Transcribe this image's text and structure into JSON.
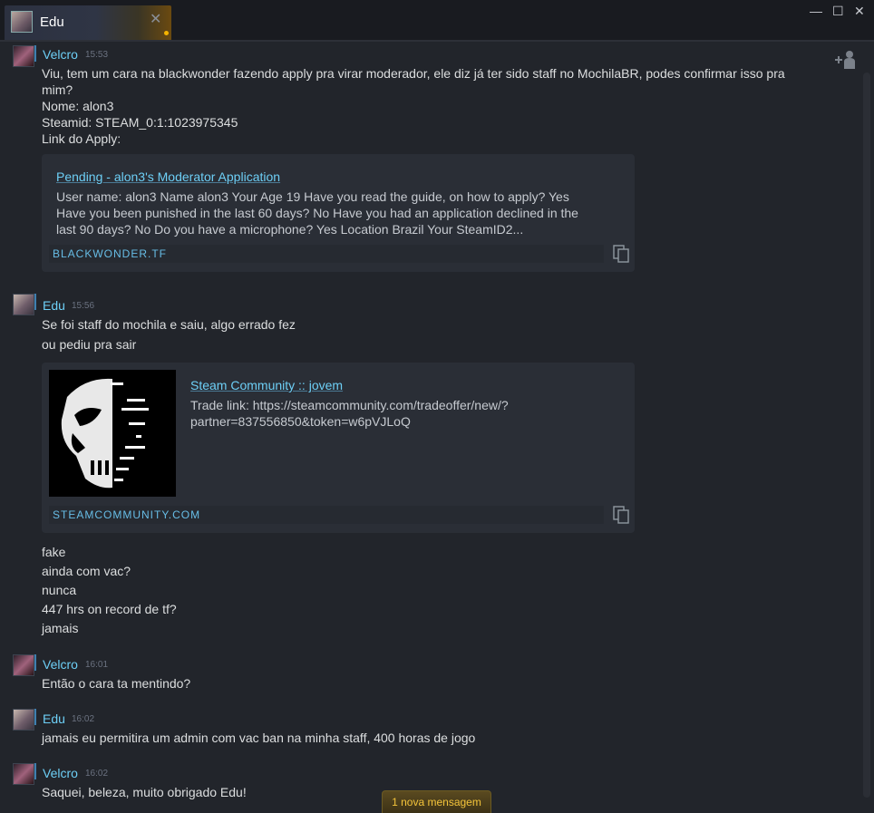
{
  "tab": {
    "title": "Edu"
  },
  "window": {
    "minimize": "—",
    "maximize": "☐",
    "close": "✕"
  },
  "messages": [
    {
      "sender": "Velcro",
      "time": "15:53",
      "lines": [
        "Viu, tem um cara na blackwonder fazendo apply pra virar moderador, ele diz já ter sido staff no MochilaBR, podes confirmar isso pra",
        "mim?",
        "Nome: alon3",
        "Steamid: STEAM_0:1:1023975345",
        "Link do Apply:"
      ],
      "embed": {
        "title": "Pending - alon3's Moderator Application",
        "desc": [
          "User name: alon3 Name alon3 Your Age 19 Have you read the guide, on how to apply? Yes",
          "Have you been punished in the last 60 days? No Have you had an application declined in the",
          "last 90 days? No Do you have a microphone? Yes Location Brazil Your SteamID2..."
        ],
        "domain": "BLACKWONDER.TF"
      }
    },
    {
      "sender": "Edu",
      "time": "15:56",
      "lines": [
        "Se foi staff do mochila e saiu, algo errado fez",
        "ou pediu pra sair"
      ],
      "embed": {
        "title": "Steam Community :: jovem",
        "desc": [
          "Trade link: https://steamcommunity.com/tradeoffer/new/?",
          "partner=837556850&token=w6pVJLoQ"
        ],
        "domain": "STEAMCOMMUNITY.COM"
      },
      "after_lines": [
        "fake",
        "ainda com vac?",
        "nunca",
        "447 hrs on record de tf?",
        "jamais"
      ]
    },
    {
      "sender": "Velcro",
      "time": "16:01",
      "lines": [
        "Então o cara ta mentindo?"
      ]
    },
    {
      "sender": "Edu",
      "time": "16:02",
      "lines": [
        "jamais eu permitira um admin com vac ban na minha staff, 400 horas de jogo"
      ]
    },
    {
      "sender": "Velcro",
      "time": "16:02",
      "lines": [
        "Saquei, beleza, muito obrigado Edu!"
      ]
    }
  ],
  "toast": {
    "label": "1 nova mensagem"
  },
  "colors": {
    "accent": "#6dcff6",
    "background": "#22252b",
    "toast": "#f3c33a"
  }
}
